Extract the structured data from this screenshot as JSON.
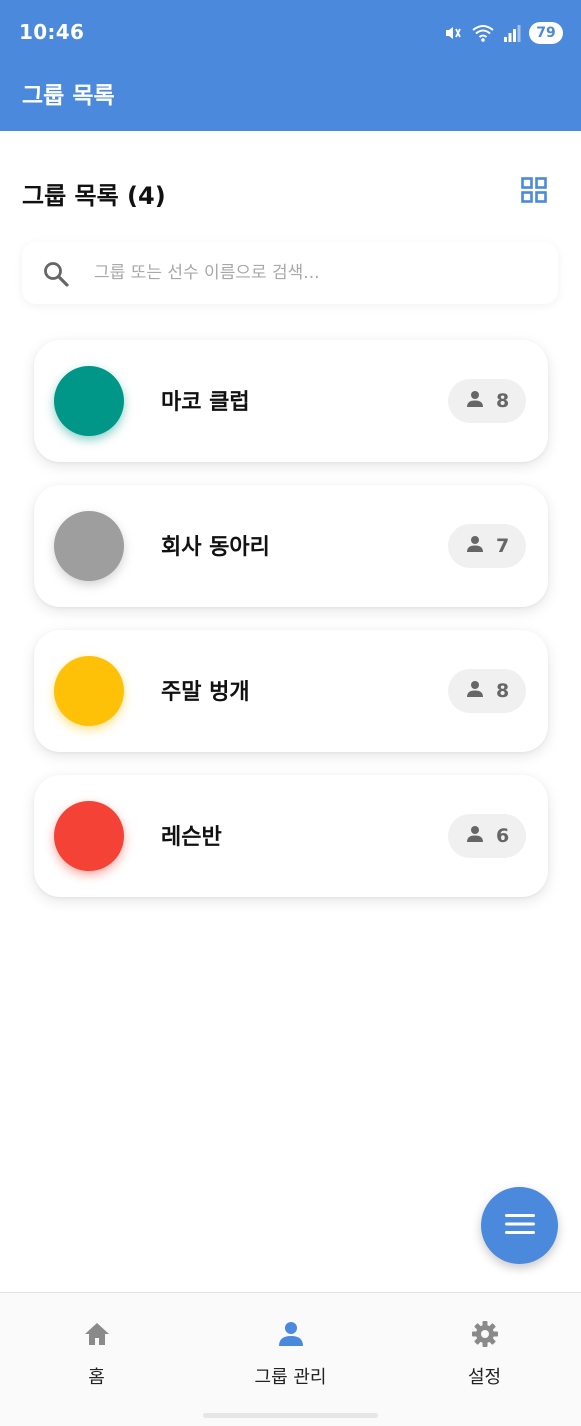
{
  "status_bar": {
    "time": "10:46",
    "battery": "79",
    "icons": [
      "mute-icon",
      "wifi-icon",
      "signal-icon"
    ]
  },
  "appbar": {
    "title": "그룹 목록"
  },
  "list": {
    "title": "그룹 목록 (4)",
    "view_toggle_icon": "grid-icon"
  },
  "search": {
    "placeholder": "그룹 또는 선수 이름으로 검색...",
    "value": ""
  },
  "groups": [
    {
      "name": "마코 클럽",
      "count": "8",
      "color": "#009688"
    },
    {
      "name": "회사 동아리",
      "count": "7",
      "color": "#9e9e9e"
    },
    {
      "name": "주말 벙개",
      "count": "8",
      "color": "#ffc107"
    },
    {
      "name": "레슨반",
      "count": "6",
      "color": "#f44336"
    }
  ],
  "fab": {
    "icon": "menu-icon"
  },
  "bottom_nav": {
    "items": [
      {
        "label": "홈",
        "icon": "home-icon",
        "active": false
      },
      {
        "label": "그룹 관리",
        "icon": "person-icon",
        "active": true
      },
      {
        "label": "설정",
        "icon": "gear-icon",
        "active": false
      }
    ]
  },
  "colors": {
    "primary": "#4a89dc",
    "nav_inactive": "#8a8a8a",
    "badge_bg": "#f0f0f0"
  }
}
